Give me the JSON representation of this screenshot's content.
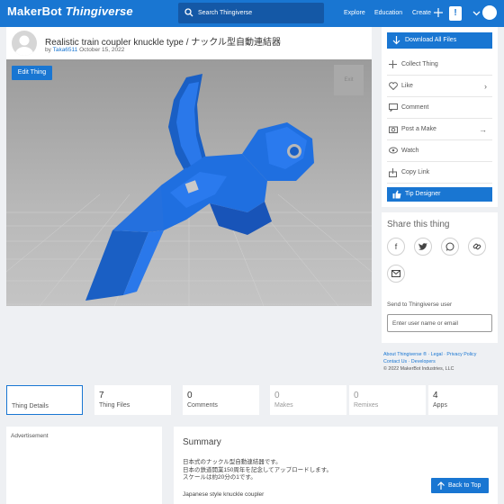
{
  "app": {
    "logo_maker": "MakerBot",
    "logo_thingiverse": "Thingiverse",
    "search_placeholder": "Search Thingiverse",
    "nav": {
      "explore": "Explore",
      "education": "Education",
      "create": "Create",
      "notifications": "!"
    }
  },
  "thing": {
    "title": "Realistic train coupler knuckle type / ナックル型自動連結器",
    "by_label": "by",
    "author": "Taka6511",
    "date": "October 15, 2022",
    "edit_label": "Edit Thing",
    "exit_label": "Exit"
  },
  "actions": {
    "download": "Download All Files",
    "collect": "Collect Thing",
    "like": "Like",
    "comment": "Comment",
    "post_make": "Post a Make",
    "watch": "Watch",
    "copy_link": "Copy Link",
    "tip": "Tip Designer"
  },
  "share": {
    "title": "Share this thing",
    "send_label": "Send to Thingiverse user",
    "input_placeholder": "Enter user name or email"
  },
  "footer": {
    "about": "About Thingiverse ®",
    "legal": "Legal",
    "privacy": "Privacy Policy",
    "contact": "Contact Us",
    "developers": "Developers",
    "copyright": "© 2022 MakerBot Industries, LLC"
  },
  "tabs": [
    {
      "num": "",
      "label": "Thing Details"
    },
    {
      "num": "7",
      "label": "Thing Files"
    },
    {
      "num": "0",
      "label": "Comments"
    },
    {
      "num": "0",
      "label": "Makes"
    },
    {
      "num": "0",
      "label": "Remixes"
    },
    {
      "num": "4",
      "label": "Apps"
    }
  ],
  "ad_label": "Advertisement",
  "summary": {
    "title": "Summary",
    "line1": "日本式のナックル型自動連結器です。",
    "line2": "日本の鉄道開業150周年を記念してアップロードします。",
    "line3": "スケールは約20分の1です。",
    "line4": "Japanese style knuckle coupler"
  },
  "back_to_top": "Back to Top",
  "colors": {
    "brand": "#1976d2",
    "model": "#1f6fe0"
  }
}
